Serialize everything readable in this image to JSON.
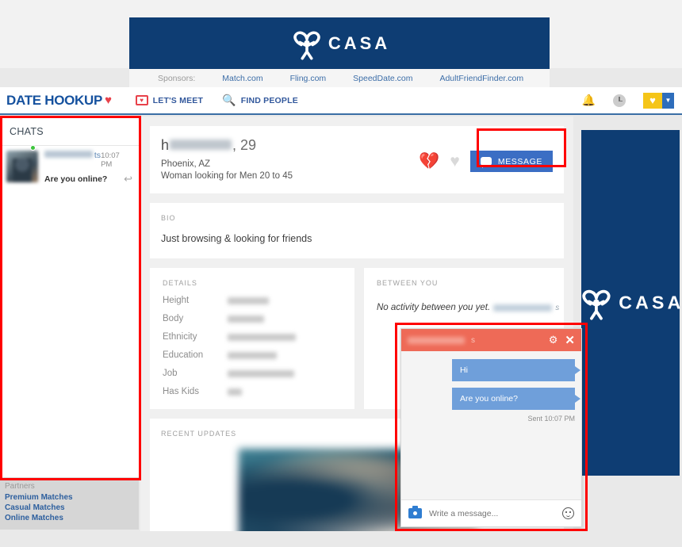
{
  "colors": {
    "brand_blue": "#15519e",
    "nav_underline": "#3a6ea5",
    "ad_navy": "#0e3d73",
    "message_button": "#3b6ec4",
    "chat_header_coral": "#ee6a57",
    "bubble_blue": "#6f9fda",
    "annotation_red": "#ff0000",
    "online_green": "#3ec43e",
    "logo_heart_red": "#e8414a",
    "badge_yellow": "#f5c518"
  },
  "banner_ad": {
    "name": "casa-banner-ad",
    "logo_text": "CASA",
    "logo_icon": "casa-heart-figure-icon"
  },
  "sponsors": {
    "label": "Sponsors:",
    "links": [
      "Match.com",
      "Fling.com",
      "SpeedDate.com",
      "AdultFriendFinder.com"
    ]
  },
  "nav": {
    "logo_text": "DATE HOOKUP",
    "logo_heart": "♥",
    "items": [
      {
        "label": "LET'S MEET",
        "icon": "photo-stack-icon"
      },
      {
        "label": "FIND PEOPLE",
        "icon": "search-icon"
      }
    ],
    "right": {
      "bell_icon": "ὑ4",
      "bell_glyph": "🔔",
      "clock_icon": "clock-icon",
      "heart_glyph": "♥",
      "caret_glyph": "▼"
    }
  },
  "sidebar": {
    "title": "CHATS",
    "chat": {
      "username_visible_tail": "ts",
      "time": "10:07 PM",
      "preview": "Are you online?",
      "reply_glyph": "↩",
      "online": true
    }
  },
  "partners": {
    "title": "Partners",
    "links": [
      "Premium Matches",
      "Casual Matches",
      "Online Matches"
    ]
  },
  "profile": {
    "name_first_letter": "h",
    "age": "29",
    "location": "Phoenix, AZ",
    "seeking": "Woman looking for Men 20 to 45",
    "actions": {
      "broken_heart_glyph": "💔",
      "heart_glyph": "♥",
      "message_label": "MESSAGE"
    },
    "bio": {
      "label": "BIO",
      "text": "Just browsing & looking for friends"
    },
    "details": {
      "label": "DETAILS",
      "rows": [
        {
          "key": "Height",
          "blur_width": 52
        },
        {
          "key": "Body",
          "blur_width": 46
        },
        {
          "key": "Ethnicity",
          "blur_width": 86
        },
        {
          "key": "Education",
          "blur_width": 62
        },
        {
          "key": "Job",
          "blur_width": 84
        },
        {
          "key": "Has Kids",
          "blur_width": 18
        }
      ]
    },
    "between_you": {
      "label": "BETWEEN YOU",
      "text": "No activity between you yet.",
      "trailing_tail": "s"
    },
    "recent_updates": {
      "label": "RECENT UPDATES"
    }
  },
  "rail_ad": {
    "logo_text": "CASA"
  },
  "chat_popup": {
    "username_visible_tail": "s",
    "gear_glyph": "⚙",
    "close_glyph": "✕",
    "messages": [
      "Hi",
      "Are you online?"
    ],
    "sent_stamp": "Sent 10:07 PM",
    "input_placeholder": "Write a message...",
    "camera_icon": "camera-icon",
    "emoji_icon": "smiley-icon"
  }
}
